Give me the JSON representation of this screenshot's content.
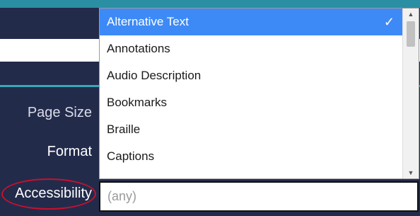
{
  "form": {
    "labels": {
      "page_size": "Page Size",
      "format": "Format",
      "accessibility": "Accessibility"
    },
    "accessibility_field": {
      "value": "",
      "placeholder": "(any)"
    }
  },
  "dropdown": {
    "options": [
      {
        "label": "Alternative Text",
        "selected": true
      },
      {
        "label": "Annotations"
      },
      {
        "label": "Audio Description"
      },
      {
        "label": "Bookmarks"
      },
      {
        "label": "Braille"
      },
      {
        "label": "Captions"
      }
    ],
    "checkmark": "✓",
    "scroll_up_glyph": "▲",
    "scroll_down_glyph": "▼"
  },
  "colors": {
    "navy": "#232b4b",
    "teal": "#2b8fa3",
    "selection": "#3d8af7",
    "highlight_circle": "#c8102e"
  }
}
